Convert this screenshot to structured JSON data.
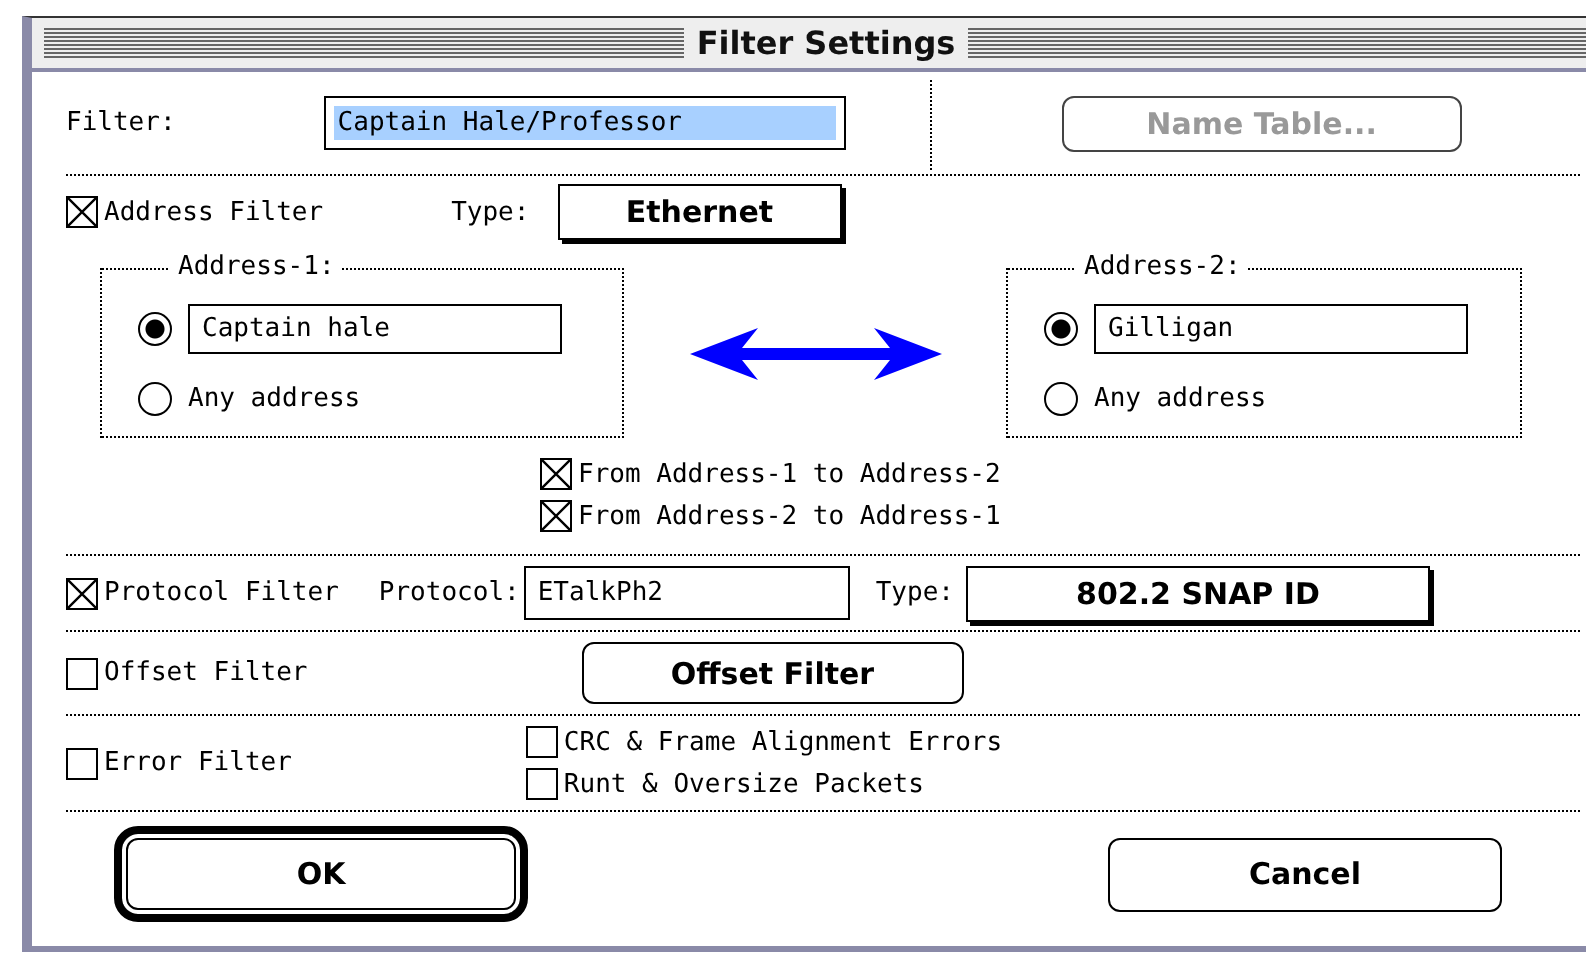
{
  "window": {
    "title": "Filter Settings"
  },
  "filter": {
    "label": "Filter:",
    "value": "Captain Hale/Professor",
    "highlighted": true
  },
  "name_table_button": {
    "label": "Name Table...",
    "disabled": true
  },
  "address_filter": {
    "label": "Address Filter",
    "checked": true,
    "type_label": "Type:",
    "type_value": "Ethernet",
    "groups": [
      {
        "title": "Address-1:",
        "options": [
          {
            "kind": "field",
            "value": "Captain hale",
            "selected": true
          },
          {
            "kind": "text",
            "label": "Any address",
            "selected": false
          }
        ]
      },
      {
        "title": "Address-2:",
        "options": [
          {
            "kind": "field",
            "value": "Gilligan",
            "selected": true
          },
          {
            "kind": "text",
            "label": "Any address",
            "selected": false
          }
        ]
      }
    ],
    "directions": [
      {
        "label": "From Address-1 to Address-2",
        "checked": true
      },
      {
        "label": "From Address-2 to Address-1",
        "checked": true
      }
    ]
  },
  "protocol_filter": {
    "label": "Protocol Filter",
    "checked": true,
    "protocol_label": "Protocol:",
    "protocol_value": "ETalkPh2",
    "type_label": "Type:",
    "type_value": "802.2 SNAP ID"
  },
  "offset_filter": {
    "label": "Offset Filter",
    "checked": false,
    "button": "Offset Filter"
  },
  "error_filter": {
    "label": "Error Filter",
    "checked": false,
    "options": [
      {
        "label": "CRC & Frame Alignment Errors",
        "checked": false
      },
      {
        "label": "Runt & Oversize Packets",
        "checked": false
      }
    ]
  },
  "buttons": [
    {
      "label": "OK",
      "default": true
    },
    {
      "label": "Cancel",
      "default": false
    }
  ]
}
